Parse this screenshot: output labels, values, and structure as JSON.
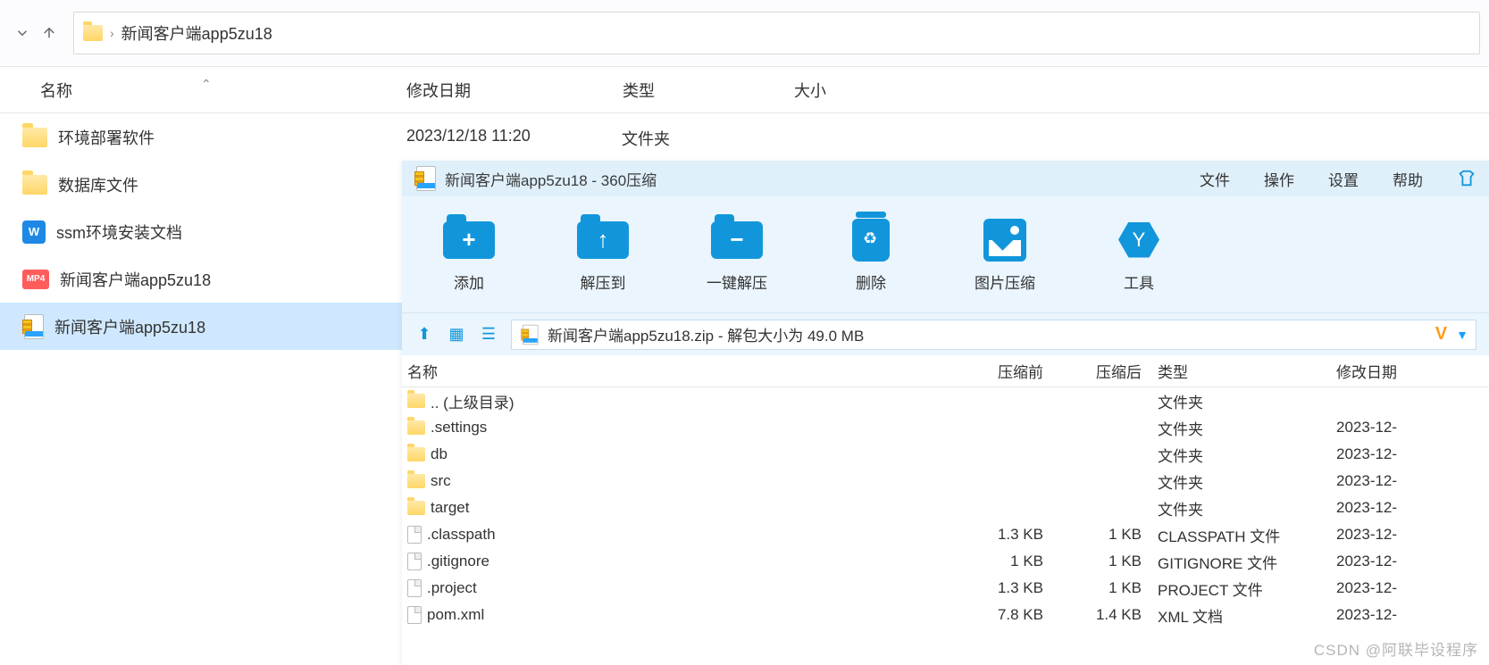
{
  "explorer": {
    "breadcrumb_sep": "›",
    "current_folder": "新闻客户端app5zu18",
    "columns": {
      "name": "名称",
      "date": "修改日期",
      "type": "类型",
      "size": "大小"
    },
    "rows": [
      {
        "icon": "folder",
        "name": "环境部署软件",
        "date": "2023/12/18 11:20",
        "type": "文件夹",
        "selected": false
      },
      {
        "icon": "folder",
        "name": "数据库文件",
        "date": "",
        "type": "",
        "selected": false
      },
      {
        "icon": "word",
        "name": "ssm环境安装文档",
        "date": "",
        "type": "",
        "selected": false
      },
      {
        "icon": "mp4",
        "name": "新闻客户端app5zu18",
        "date": "",
        "type": "",
        "selected": false
      },
      {
        "icon": "zip",
        "name": "新闻客户端app5zu18",
        "date": "",
        "type": "",
        "selected": true
      }
    ]
  },
  "zip": {
    "title": "新闻客户端app5zu18 - 360压缩",
    "menus": {
      "file": "文件",
      "action": "操作",
      "settings": "设置",
      "help": "帮助"
    },
    "toolbar": {
      "add": "添加",
      "extract_to": "解压到",
      "one_click": "一键解压",
      "delete": "删除",
      "image_compress": "图片压缩",
      "tools": "工具"
    },
    "path_text": "新闻客户端app5zu18.zip - 解包大小为 49.0 MB",
    "columns": {
      "name": "名称",
      "pre": "压缩前",
      "post": "压缩后",
      "type": "类型",
      "date": "修改日期"
    },
    "rows": [
      {
        "icon": "folder",
        "name": ".. (上级目录)",
        "pre": "",
        "post": "",
        "type": "文件夹",
        "date": ""
      },
      {
        "icon": "folder",
        "name": ".settings",
        "pre": "",
        "post": "",
        "type": "文件夹",
        "date": "2023-12-"
      },
      {
        "icon": "folder",
        "name": "db",
        "pre": "",
        "post": "",
        "type": "文件夹",
        "date": "2023-12-"
      },
      {
        "icon": "folder",
        "name": "src",
        "pre": "",
        "post": "",
        "type": "文件夹",
        "date": "2023-12-"
      },
      {
        "icon": "folder",
        "name": "target",
        "pre": "",
        "post": "",
        "type": "文件夹",
        "date": "2023-12-"
      },
      {
        "icon": "file",
        "name": ".classpath",
        "pre": "1.3 KB",
        "post": "1 KB",
        "type": "CLASSPATH 文件",
        "date": "2023-12-"
      },
      {
        "icon": "file",
        "name": ".gitignore",
        "pre": "1 KB",
        "post": "1 KB",
        "type": "GITIGNORE 文件",
        "date": "2023-12-"
      },
      {
        "icon": "file",
        "name": ".project",
        "pre": "1.3 KB",
        "post": "1 KB",
        "type": "PROJECT 文件",
        "date": "2023-12-"
      },
      {
        "icon": "file",
        "name": "pom.xml",
        "pre": "7.8 KB",
        "post": "1.4 KB",
        "type": "XML 文档",
        "date": "2023-12-"
      }
    ]
  },
  "watermark": "CSDN @阿联毕设程序"
}
